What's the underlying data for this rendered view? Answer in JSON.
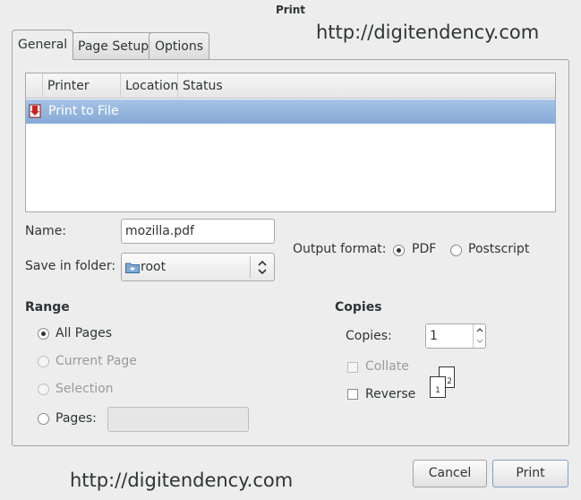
{
  "window": {
    "title": "Print"
  },
  "watermark": {
    "text": "http://digitendency.com"
  },
  "tabs": [
    {
      "label": "General",
      "active": true
    },
    {
      "label": "Page Setup",
      "active": false
    },
    {
      "label": "Options",
      "active": false
    }
  ],
  "printer_list": {
    "columns": [
      "Printer",
      "Location",
      "Status"
    ],
    "rows": [
      {
        "printer": "Print to File",
        "location": "",
        "status": "",
        "selected": true
      }
    ]
  },
  "file": {
    "name_label": "Name:",
    "name_value": "mozilla.pdf",
    "folder_label": "Save in folder:",
    "folder_value": "root"
  },
  "output_format": {
    "label": "Output format:",
    "options": [
      "PDF",
      "Postscript"
    ],
    "selected": "PDF"
  },
  "range": {
    "title": "Range",
    "all_pages": "All Pages",
    "current_page": "Current Page",
    "selection": "Selection",
    "pages": "Pages:",
    "pages_value": "",
    "selected": "All Pages"
  },
  "copies": {
    "title": "Copies",
    "copies_label": "Copies:",
    "copies_value": "1",
    "collate": "Collate",
    "reverse": "Reverse",
    "page_icons": [
      "1",
      "2"
    ]
  },
  "buttons": {
    "cancel": "Cancel",
    "print": "Print"
  },
  "colors": {
    "selection": "#86a9d6",
    "background": "#ededed"
  }
}
